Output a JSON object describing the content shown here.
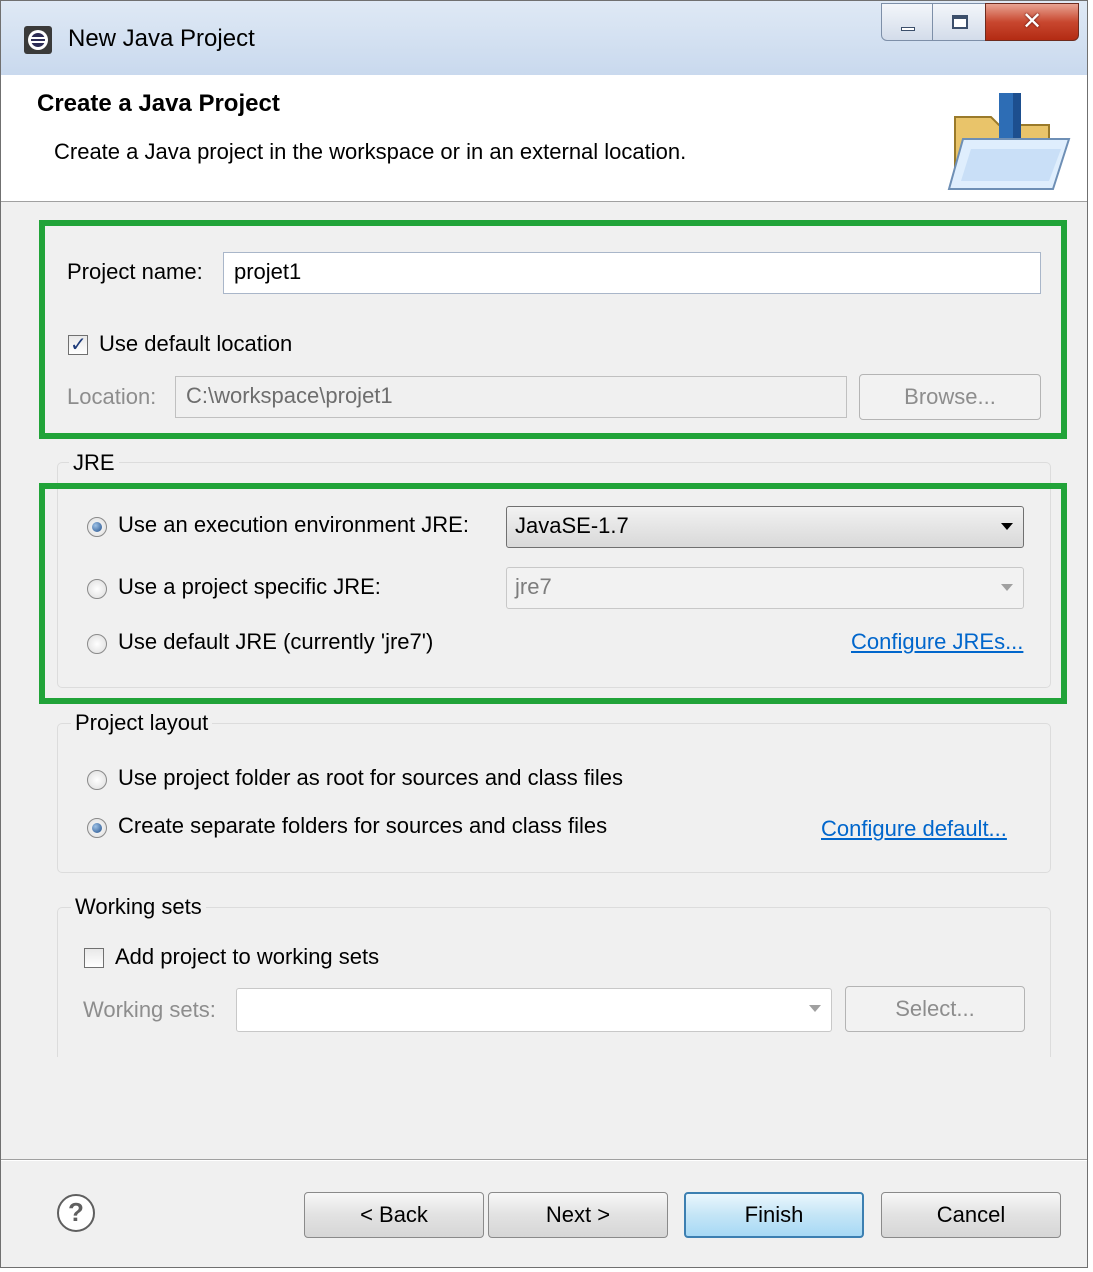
{
  "window": {
    "title": "New Java Project"
  },
  "header": {
    "title": "Create a Java Project",
    "description": "Create a Java project in the workspace or in an external location."
  },
  "project": {
    "name_label": "Project name:",
    "name_value": "projet1",
    "default_location_label": "Use default location",
    "default_location_checked": true,
    "location_label": "Location:",
    "location_value": "C:\\workspace\\projet1",
    "browse_label": "Browse..."
  },
  "jre": {
    "group_title": "JRE",
    "option_execution_env": "Use an execution environment JRE:",
    "execution_env_value": "JavaSE-1.7",
    "option_project_specific": "Use a project specific JRE:",
    "project_specific_value": "jre7",
    "option_default": "Use default JRE (currently 'jre7')",
    "configure_link": "Configure JREs...",
    "selected": "execution_env"
  },
  "layout": {
    "group_title": "Project layout",
    "option_root": "Use project folder as root for sources and class files",
    "option_separate": "Create separate folders for sources and class files",
    "configure_link": "Configure default...",
    "selected": "separate"
  },
  "working_sets": {
    "group_title": "Working sets",
    "add_label": "Add project to working sets",
    "add_checked": false,
    "sets_label": "Working sets:",
    "sets_value": "",
    "select_label": "Select..."
  },
  "footer": {
    "back_label": "< Back",
    "next_label": "Next >",
    "finish_label": "Finish",
    "cancel_label": "Cancel"
  },
  "colors": {
    "highlight": "#21a339",
    "link": "#0066cc",
    "background": "#f0f0f0"
  },
  "icons": [
    "eclipse-app-icon",
    "minimize-icon",
    "maximize-icon",
    "close-icon",
    "java-project-folder-icon",
    "help-icon",
    "dropdown-arrow-icon"
  ]
}
